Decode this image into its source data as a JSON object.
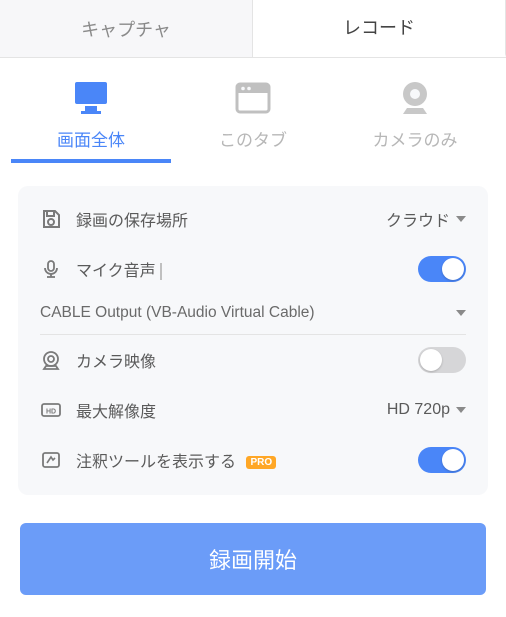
{
  "topTabs": {
    "capture": "キャプチャ",
    "record": "レコード"
  },
  "modeTabs": {
    "fullscreen": "画面全体",
    "thistab": "このタブ",
    "camera": "カメラのみ"
  },
  "settings": {
    "saveLocation": {
      "label": "録画の保存場所",
      "value": "クラウド"
    },
    "micAudio": {
      "label": "マイク音声",
      "device": "CABLE Output (VB-Audio Virtual Cable)"
    },
    "cameraVideo": {
      "label": "カメラ映像"
    },
    "maxResolution": {
      "label": "最大解像度",
      "value": "HD 720p"
    },
    "annotationTools": {
      "label": "注釈ツールを表示する",
      "badge": "PRO"
    }
  },
  "startButton": "録画開始"
}
